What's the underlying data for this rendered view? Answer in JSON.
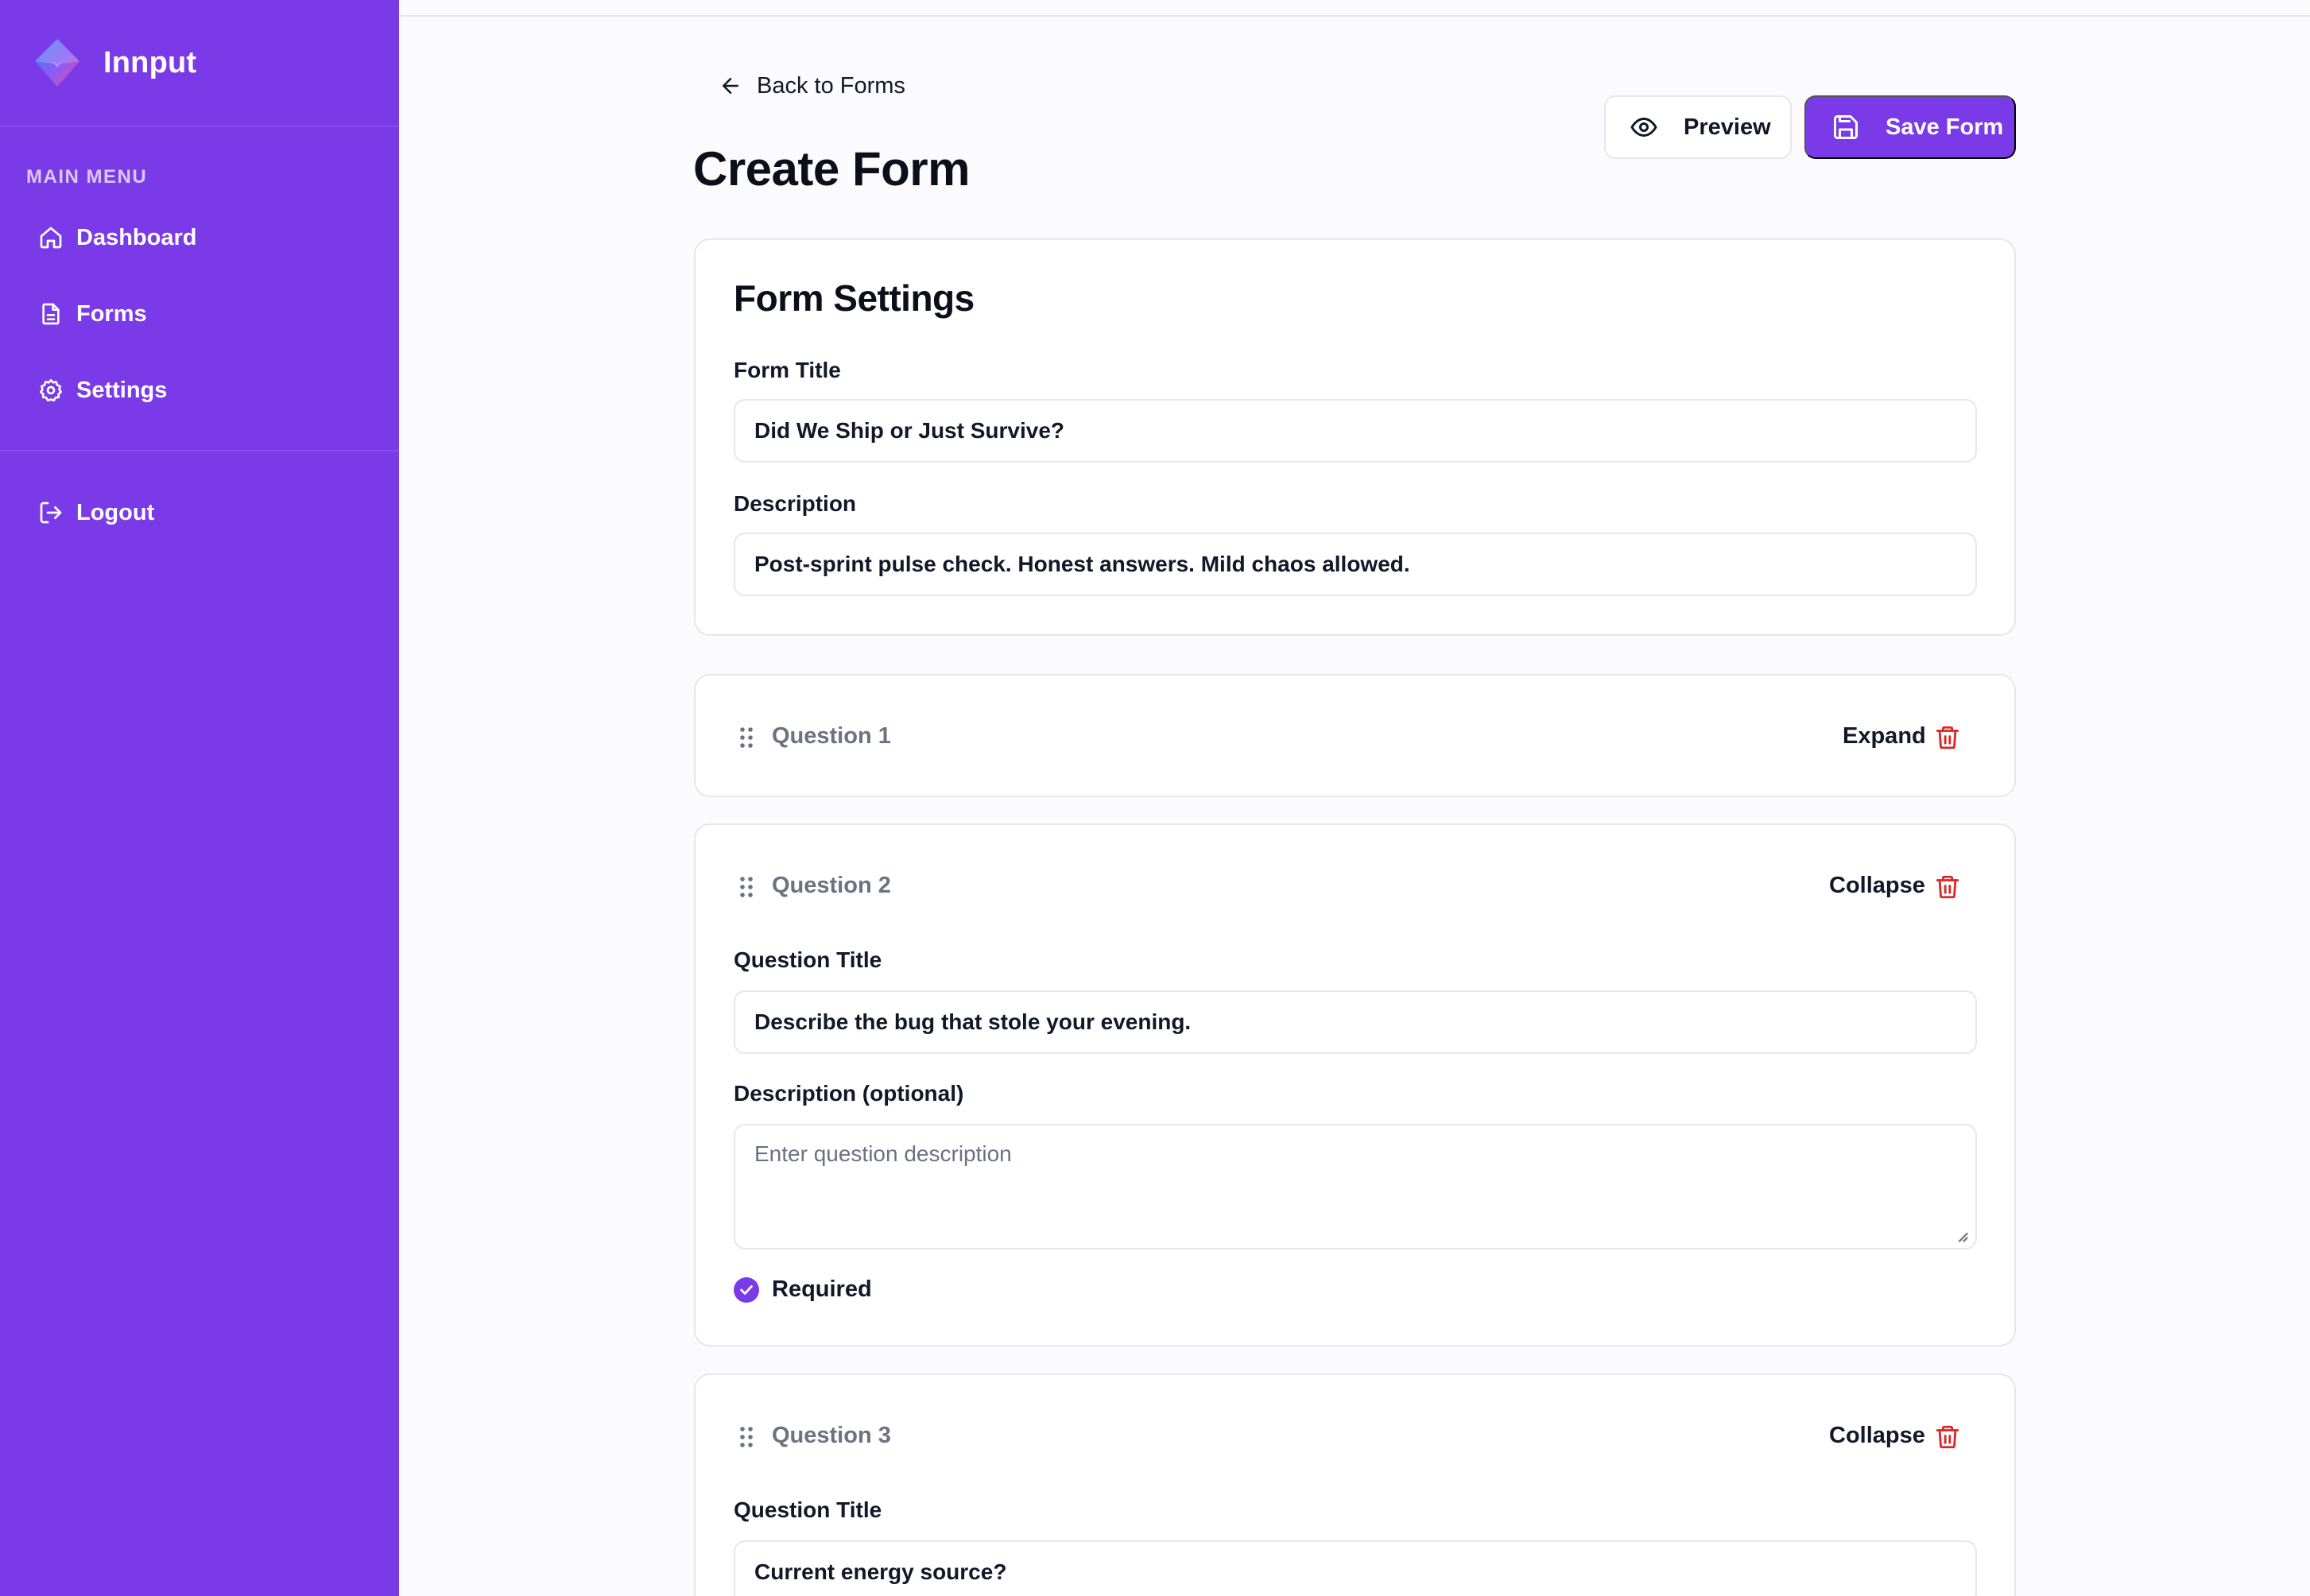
{
  "sidebar": {
    "brand": "Innput",
    "menu_label": "MAIN MENU",
    "items": [
      {
        "label": "Dashboard",
        "icon": "home-icon"
      },
      {
        "label": "Forms",
        "icon": "document-icon"
      },
      {
        "label": "Settings",
        "icon": "gear-icon"
      }
    ],
    "logout": {
      "label": "Logout",
      "icon": "logout-icon"
    }
  },
  "header": {
    "back_link": "Back to Forms",
    "title": "Create Form",
    "preview_label": "Preview",
    "save_label": "Save Form"
  },
  "form_settings": {
    "heading": "Form Settings",
    "title_label": "Form Title",
    "title_value": "Did We Ship or Just Survive?",
    "description_label": "Description",
    "description_value": "Post-sprint pulse check. Honest answers. Mild chaos allowed."
  },
  "questions": [
    {
      "name": "Question 1",
      "toggle": "Expand"
    },
    {
      "name": "Question 2",
      "toggle": "Collapse",
      "title_label": "Question Title",
      "title_value": "Describe the bug that stole your evening.",
      "description_label": "Description (optional)",
      "description_placeholder": "Enter question description",
      "required_label": "Required",
      "required": true
    },
    {
      "name": "Question 3",
      "toggle": "Collapse",
      "title_label": "Question Title",
      "title_value": "Current energy source?"
    }
  ],
  "colors": {
    "accent": "#7a3ae8",
    "danger": "#dc2626",
    "muted": "#6b7280",
    "border": "#e5e7eb"
  }
}
